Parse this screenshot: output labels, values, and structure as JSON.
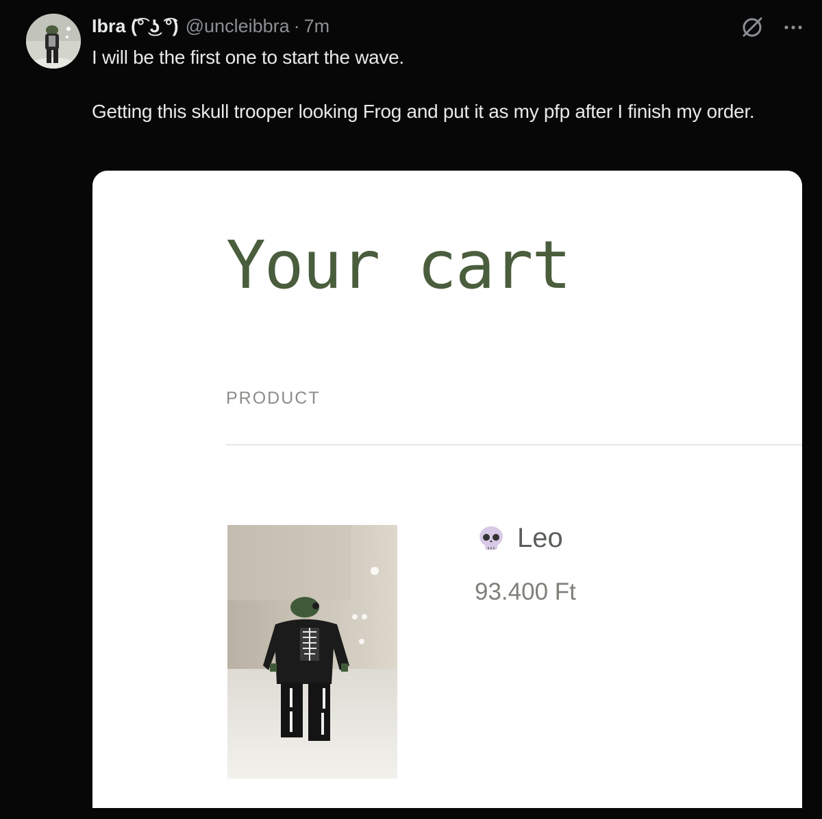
{
  "tweet": {
    "display_name": "Ibra (͡° ͜ʖ ͡°)",
    "handle": "@uncleibbra",
    "separator": "·",
    "time": "7m",
    "text_line1": "I will be the first one to start the wave.",
    "text_line2": "Getting this skull trooper looking Frog and put it as my pfp after I finish my order."
  },
  "icons": {
    "grok": "grok-icon",
    "more": "more-options-icon",
    "avatar": "avatar-frog"
  },
  "cart": {
    "title": "Your cart",
    "column_header": "PRODUCT",
    "item": {
      "emoji": "💀",
      "name": "Leo",
      "price": "93.400 Ft"
    }
  },
  "colors": {
    "background": "#070707",
    "text_primary": "#e7e9ea",
    "text_secondary": "#8b8f94",
    "cart_title": "#4a5d3c"
  }
}
